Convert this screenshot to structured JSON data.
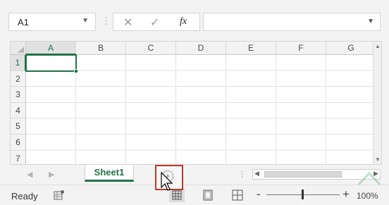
{
  "formula_bar": {
    "name_box": "A1",
    "name_box_icon": "chevron-down-icon",
    "cancel_icon": "✕",
    "enter_icon": "✓",
    "function_label": "fx",
    "formula_value": "",
    "expand_icon": "chevron-down-icon"
  },
  "grid": {
    "columns": [
      "A",
      "B",
      "C",
      "D",
      "E",
      "F",
      "G"
    ],
    "rows": [
      "1",
      "2",
      "3",
      "4",
      "5",
      "6",
      "7"
    ],
    "active_cell": "A1",
    "accent_color": "#217346"
  },
  "sheet_tabs": {
    "tabs": [
      {
        "label": "Sheet1",
        "active": true
      }
    ],
    "add_sheet_icon": "⊕",
    "highlight_color": "#c0392b"
  },
  "status_bar": {
    "status": "Ready",
    "zoom_level": "100%",
    "zoom_minus": "-",
    "zoom_plus": "+"
  }
}
